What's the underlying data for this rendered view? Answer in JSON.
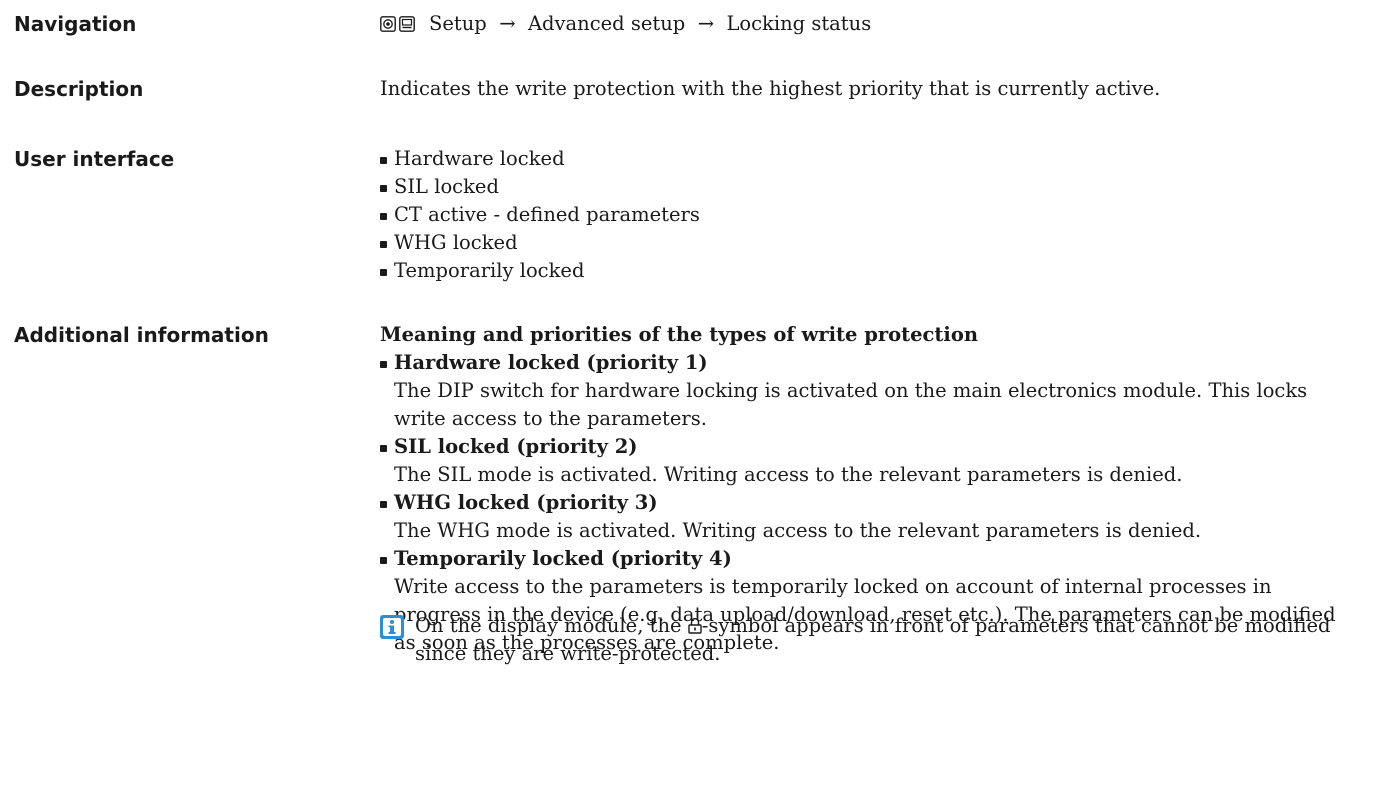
{
  "navigation": {
    "label": "Navigation",
    "path": [
      "Setup",
      "Advanced setup",
      "Locking status"
    ],
    "separator": "→",
    "icons": [
      "operating-menu-icon",
      "display-icon"
    ]
  },
  "description": {
    "label": "Description",
    "text": "Indicates the write protection with the highest priority that is currently active."
  },
  "user_interface": {
    "label": "User interface",
    "options": [
      "Hardware locked",
      "SIL locked",
      "CT active - defined parameters",
      "WHG locked",
      "Temporarily locked"
    ]
  },
  "additional_information": {
    "label": "Additional information",
    "heading": "Meaning and priorities of the types of write protection",
    "items": [
      {
        "title": "Hardware locked (priority 1)",
        "text": "The DIP switch for hardware locking is activated on the main electronics module. This locks write access to the parameters."
      },
      {
        "title": "SIL locked (priority 2)",
        "text": "The SIL mode is activated. Writing access to the relevant parameters is denied."
      },
      {
        "title": "WHG locked (priority 3)",
        "text": "The WHG mode is activated. Writing access to the relevant parameters is denied."
      },
      {
        "title": "Temporarily locked (priority 4)",
        "text": "Write access to the parameters is temporarily locked on account of internal processes in progress in the device (e.g. data upload/download, reset etc.). The parameters can be modified as soon as the processes are complete."
      }
    ],
    "note_before": "On the display module, the ",
    "note_after": "-symbol appears in front of parameters that cannot be modified since they are write-protected.",
    "note_icon": "info-icon",
    "lock_icon": "lock-icon"
  },
  "colors": {
    "info_blue": "#2a8fd6",
    "text": "#1a1a1a"
  }
}
